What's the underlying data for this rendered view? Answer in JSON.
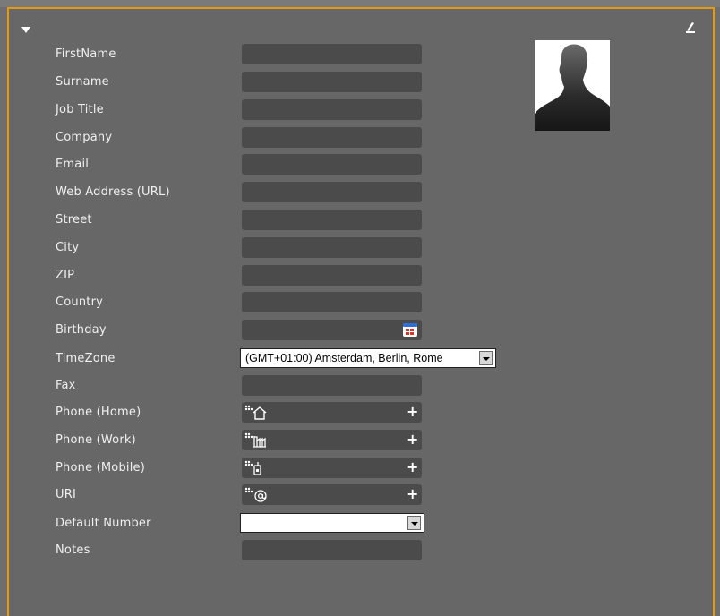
{
  "form": {
    "fields": {
      "firstname": "FirstName",
      "surname": "Surname",
      "job_title": "Job Title",
      "company": "Company",
      "email": "Email",
      "web": "Web Address (URL)",
      "street": "Street",
      "city": "City",
      "zip": "ZIP",
      "country": "Country",
      "birthday": "Birthday",
      "timezone": "TimeZone",
      "fax": "Fax",
      "phone_home": "Phone (Home)",
      "phone_work": "Phone (Work)",
      "phone_mobile": "Phone (Mobile)",
      "uri": "URI",
      "default_number": "Default Number",
      "notes": "Notes"
    },
    "timezone_value": "(GMT+01:00) Amsterdam, Berlin, Rome",
    "default_number_value": "",
    "phone_icons": {
      "home": "home-icon",
      "work": "office-icon",
      "mobile": "mobile-phone-icon",
      "uri": "at-sign-icon"
    },
    "add_label": "+"
  },
  "icons": {
    "collapse": "triangle-down-icon",
    "edit": "edit-pencil-icon",
    "calendar": "calendar-icon",
    "avatar": "person-silhouette-icon"
  },
  "colors": {
    "accent": "#e39a12",
    "panel": "#676767",
    "field": "#4b4b4b"
  }
}
